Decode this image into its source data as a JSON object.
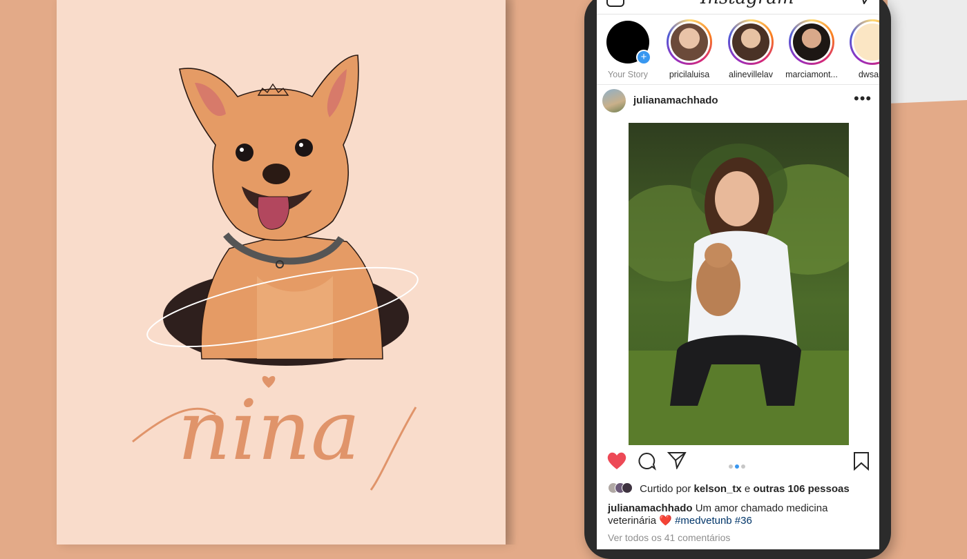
{
  "poster": {
    "name_text": "nina"
  },
  "app": {
    "logo": "Instagram"
  },
  "stories": [
    {
      "username": "Your Story",
      "own": true
    },
    {
      "username": "pricilaluisa"
    },
    {
      "username": "alinevillelav"
    },
    {
      "username": "marciamont..."
    },
    {
      "username": "dwsarq"
    }
  ],
  "post": {
    "username": "julianamachhado",
    "more_label": "•••",
    "carousel": {
      "count": 3,
      "active_index": 1
    },
    "likes": {
      "prefix": "Curtido por",
      "first_user": "kelson_tx",
      "joiner": "e",
      "others": "outras 106 pessoas"
    },
    "caption": {
      "username": "julianamachhado",
      "text": "Um amor chamado medicina veterinária",
      "emoji": "❤️",
      "hashtags": "#medvetunb #36"
    },
    "view_comments": "Ver todos os 41 comentários"
  },
  "colors": {
    "background": "#e3aa88",
    "poster": "#f9dccb",
    "lettering": "#e0946a",
    "like_red": "#ed4956",
    "accent_blue": "#3897f0"
  }
}
